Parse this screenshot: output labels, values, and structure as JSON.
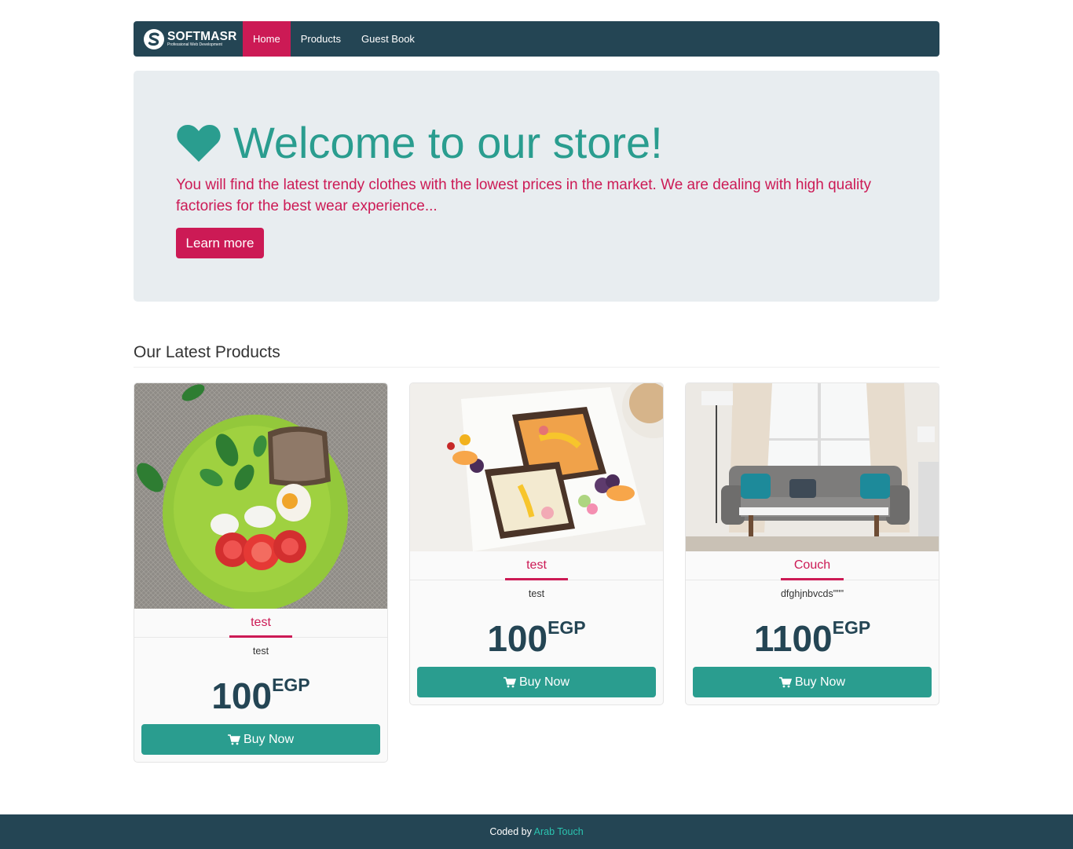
{
  "navbar": {
    "brand": {
      "name": "SOFTMASR",
      "tagline": "Professional Web Development"
    },
    "items": [
      {
        "label": "Home",
        "active": true
      },
      {
        "label": "Products",
        "active": false
      },
      {
        "label": "Guest Book",
        "active": false
      }
    ]
  },
  "hero": {
    "icon": "heart-icon",
    "title": "Welcome to our store!",
    "lead": "You will find the latest trendy clothes with the lowest prices in the market. We are dealing with high quality factories for the best wear experience...",
    "button_label": "Learn more"
  },
  "products_section": {
    "title": "Our Latest Products",
    "items": [
      {
        "title": "test",
        "description": "test",
        "price": "100",
        "currency": "EGP",
        "image": "salad-plate-photo",
        "button_label": "Buy Now"
      },
      {
        "title": "test",
        "description": "test",
        "price": "100",
        "currency": "EGP",
        "image": "toast-breakfast-photo",
        "button_label": "Buy Now"
      },
      {
        "title": "Couch",
        "description": "dfghjnbvcds\"\"\"",
        "price": "1100",
        "currency": "EGP",
        "image": "living-room-couch-photo",
        "button_label": "Buy Now"
      }
    ]
  },
  "footer": {
    "prefix": "Coded by",
    "link_text": "Arab Touch"
  },
  "colors": {
    "navbar_bg": "#244554",
    "accent": "#cc1a55",
    "teal": "#2a9d8f",
    "jumbotron_bg": "#e8edf0",
    "footer_link": "#2bc4b0"
  }
}
